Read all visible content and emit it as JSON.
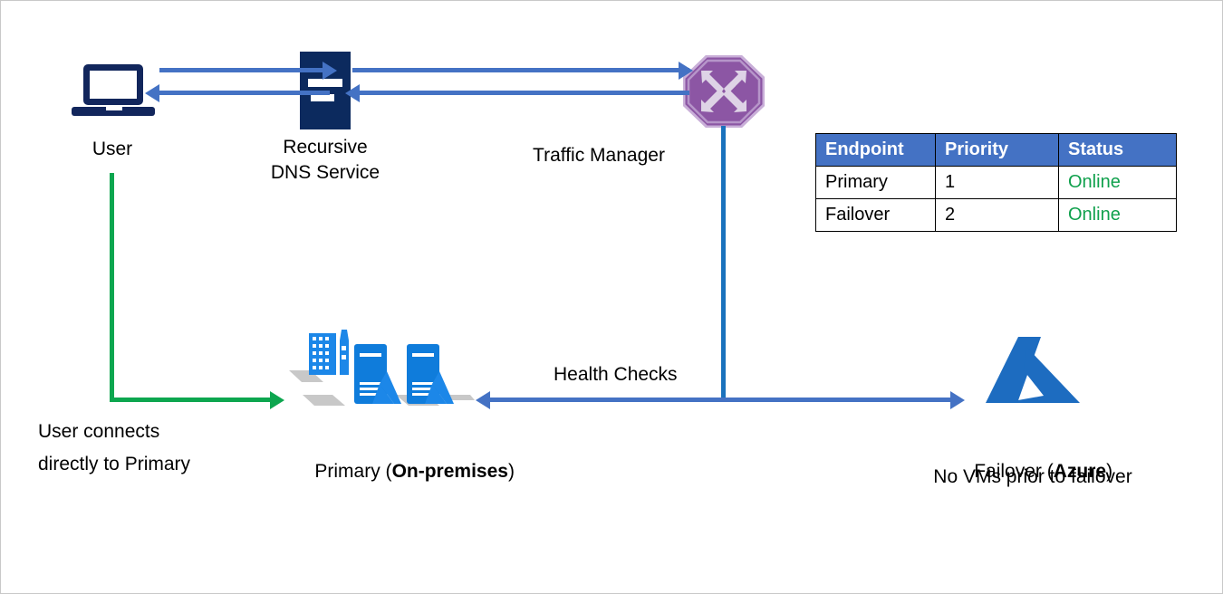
{
  "diagram": {
    "title": "Azure Traffic Manager priority failover with on-premises primary endpoint",
    "colors": {
      "blue_arrow": "#4472C4",
      "green_arrow": "#0DA64F",
      "traffic_manager_line": "#1A72BD",
      "traffic_manager_purple": "#8C56A4",
      "navy": "#0C2A5E",
      "azure_blue": "#1D6CC0",
      "table_header": "#4472C4",
      "status_online": "#0FA04C",
      "page_border": "#C8C8C8"
    }
  },
  "nodes": {
    "user": {
      "label": "User",
      "icon": "laptop-icon"
    },
    "dns": {
      "label_line1": "Recursive",
      "label_line2": "DNS Service",
      "icon": "dns-server-icon"
    },
    "traffic_manager": {
      "label": "Traffic Manager",
      "icon": "traffic-manager-icon"
    },
    "primary": {
      "label_prefix": "Primary (",
      "label_bold": "On-premises",
      "label_suffix": ")",
      "icon": "on-premises-datacenter-icon"
    },
    "failover": {
      "label_prefix": "Failover (",
      "label_bold": "Azure",
      "label_suffix": ")",
      "label_line2": "No VMs prior to failover",
      "icon": "azure-logo-icon"
    }
  },
  "annotations": {
    "health_checks": "Health Checks",
    "user_connects": "User connects\ndirectly to Primary",
    "user_connects_line1": "User connects",
    "user_connects_line2": "directly to Primary"
  },
  "table": {
    "name": "endpoint-status-table",
    "headers": [
      "Endpoint",
      "Priority",
      "Status"
    ],
    "rows": [
      {
        "endpoint": "Primary",
        "priority": "1",
        "status": "Online"
      },
      {
        "endpoint": "Failover",
        "priority": "2",
        "status": "Online"
      }
    ]
  }
}
